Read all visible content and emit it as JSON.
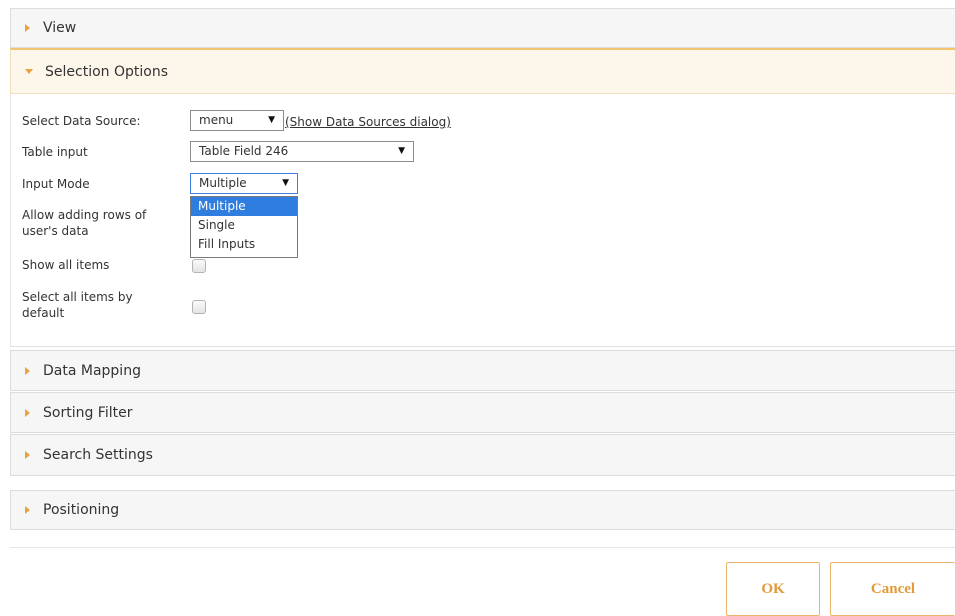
{
  "panels": {
    "view": "View",
    "selection_options": "Selection Options",
    "data_mapping": "Data Mapping",
    "sorting_filter": "Sorting Filter",
    "search_settings": "Search Settings",
    "positioning": "Positioning"
  },
  "selection_form": {
    "data_source_label": "Select Data Source:",
    "data_source_value": "menu",
    "data_sources_link": "(Show Data Sources dialog)",
    "table_input_label": "Table input",
    "table_input_value": "Table Field 246",
    "input_mode_label": "Input Mode",
    "input_mode_value": "Multiple",
    "input_mode_options": [
      "Multiple",
      "Single",
      "Fill Inputs"
    ],
    "allow_adding_rows_label_line1": "Allow adding rows of",
    "allow_adding_rows_label_line2": "user's data",
    "show_all_items_label": "Show all items",
    "select_all_default_label_line1": "Select all items by",
    "select_all_default_label_line2": "default"
  },
  "footer": {
    "ok_label": "OK",
    "cancel_label": "Cancel"
  },
  "colors": {
    "accent": "#e8a33d",
    "selected_option": "#2f7ddf"
  }
}
